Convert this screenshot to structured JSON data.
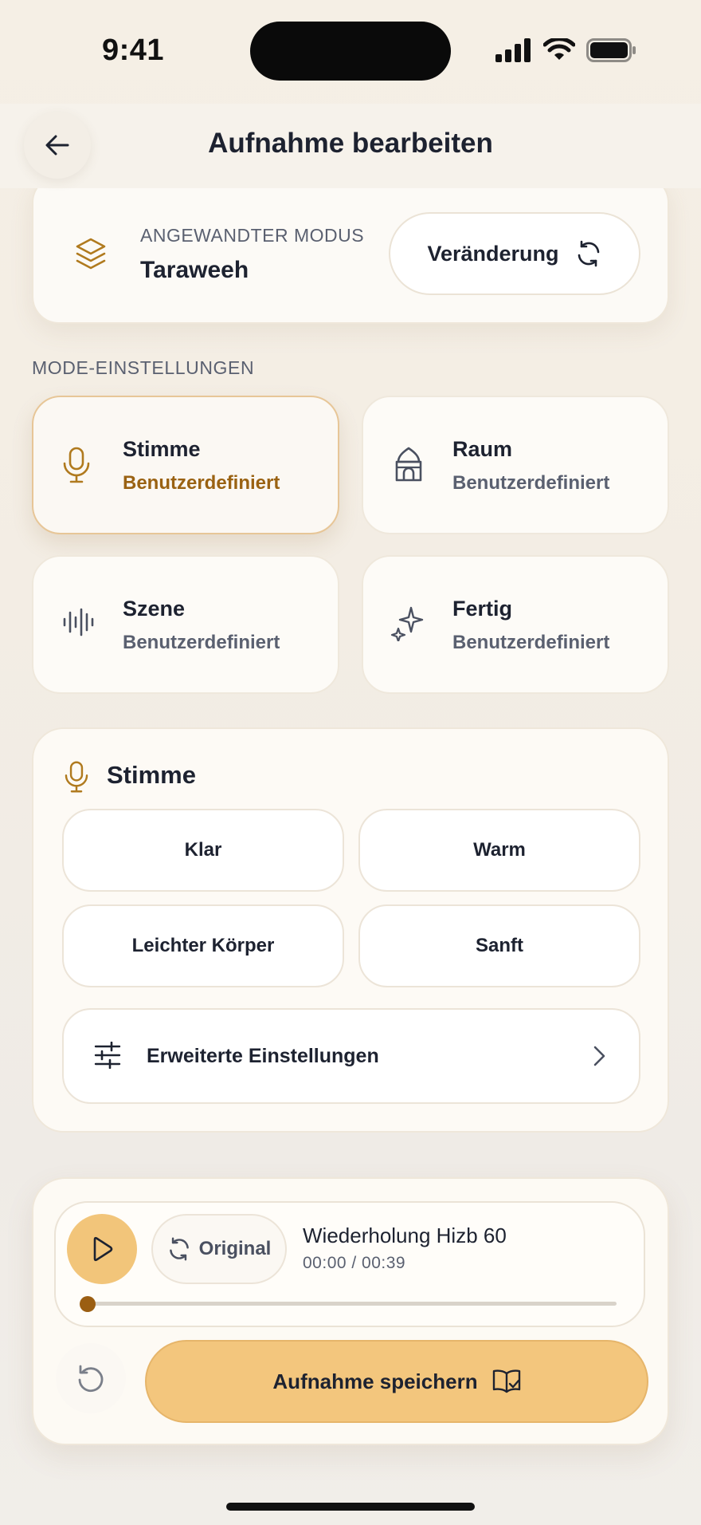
{
  "status_bar": {
    "time": "9:41"
  },
  "header": {
    "title": "Aufnahme bearbeiten",
    "back_icon": "arrow-left-icon"
  },
  "mode": {
    "kicker": "ANGEWANDTER MODUS",
    "value": "Taraweeh",
    "icon": "layers-icon",
    "change_label": "Veränderung",
    "change_icon": "refresh-icon"
  },
  "settings": {
    "section_label": "MODE-EINSTELLUNGEN",
    "tiles": [
      {
        "name": "Stimme",
        "sub": "Benutzerdefiniert",
        "icon": "microphone-icon",
        "active": true
      },
      {
        "name": "Raum",
        "sub": "Benutzerdefiniert",
        "icon": "mosque-icon",
        "active": false
      },
      {
        "name": "Szene",
        "sub": "Benutzerdefiniert",
        "icon": "waveform-icon",
        "active": false
      },
      {
        "name": "Fertig",
        "sub": "Benutzerdefiniert",
        "icon": "sparkle-icon",
        "active": false
      }
    ]
  },
  "voice": {
    "title": "Stimme",
    "options": [
      "Klar",
      "Warm",
      "Leichter Körper",
      "Sanft"
    ],
    "advanced_label": "Erweiterte Einstellungen"
  },
  "player": {
    "original_label": "Original",
    "track_title": "Wiederholung Hizb 60",
    "time": "00:00 / 00:39",
    "progress": 0,
    "save_label": "Aufnahme speichern"
  },
  "colors": {
    "accent": "#f3c67d",
    "accent_dark": "#9b5e12",
    "icon_gold": "#b07a1e",
    "text": "#1d2230",
    "muted": "#5a6070"
  }
}
